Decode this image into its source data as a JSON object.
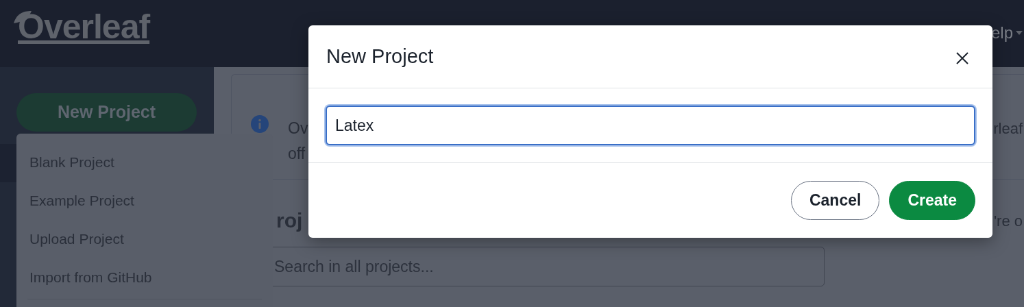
{
  "navbar": {
    "brand": "Overleaf",
    "menu_fragment": "elp"
  },
  "sidebar": {
    "new_project_button": "New Project"
  },
  "new_project_menu": {
    "expanded": true,
    "items": [
      {
        "label": "Blank Project"
      },
      {
        "label": "Example Project"
      },
      {
        "label": "Upload Project"
      },
      {
        "label": "Import from GitHub"
      }
    ]
  },
  "notice": {
    "left_lines": [
      "Ov",
      "off"
    ],
    "right_fragment": "rleaf"
  },
  "projects": {
    "heading_fragment": "roj",
    "right_fragment": "'re o",
    "search": {
      "placeholder": "Search in all projects..."
    }
  },
  "modal": {
    "title": "New Project",
    "input": {
      "value": "Latex"
    },
    "buttons": [
      {
        "label": "Cancel",
        "kind": "secondary"
      },
      {
        "label": "Create",
        "kind": "primary"
      }
    ]
  }
}
